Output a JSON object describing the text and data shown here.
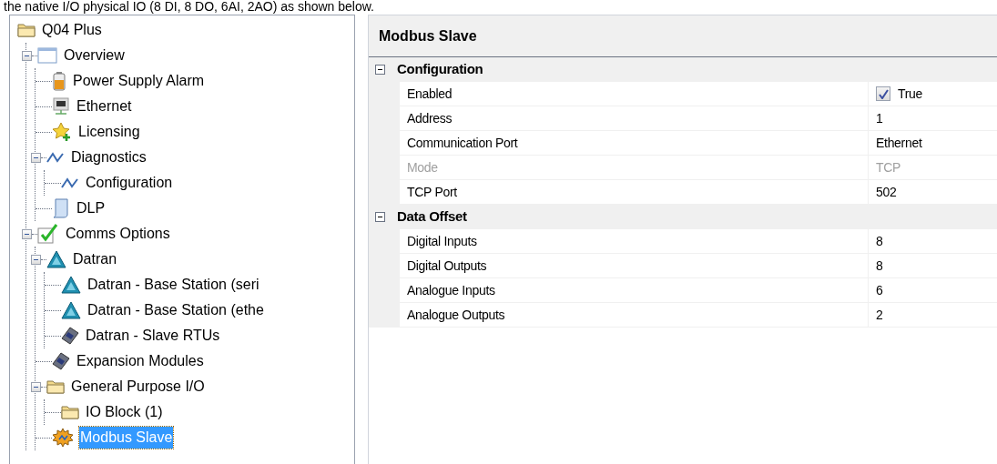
{
  "caption": "the native I/O physical IO (8 DI, 8 DO, 6AI, 2AO) as shown below.",
  "tree": [
    {
      "label": "Q04 Plus",
      "kind": "folder",
      "selected": false,
      "children": [
        {
          "label": "Overview",
          "kind": "window",
          "selected": false,
          "expanded": true,
          "children": [
            {
              "label": "Power Supply Alarm",
              "kind": "battery",
              "selected": false
            },
            {
              "label": "Ethernet",
              "kind": "network",
              "selected": false
            },
            {
              "label": "Licensing",
              "kind": "star",
              "selected": false
            },
            {
              "label": "Diagnostics",
              "kind": "wave",
              "selected": false,
              "expanded": true,
              "children": [
                {
                  "label": "Configuration",
                  "kind": "wave",
                  "selected": false
                }
              ]
            },
            {
              "label": "DLP",
              "kind": "document",
              "selected": false
            }
          ]
        },
        {
          "label": "Comms Options",
          "kind": "check",
          "selected": false,
          "expanded": true,
          "children": [
            {
              "label": "Datran",
              "kind": "triangle",
              "selected": false,
              "expanded": true,
              "children": [
                {
                  "label": "Datran - Base Station (seri",
                  "kind": "triangle",
                  "selected": false
                },
                {
                  "label": "Datran - Base Station (ethe",
                  "kind": "triangle",
                  "selected": false
                },
                {
                  "label": "Datran - Slave RTUs",
                  "kind": "module",
                  "selected": false
                }
              ]
            },
            {
              "label": "Expansion Modules",
              "kind": "module",
              "selected": false
            },
            {
              "label": "General Purpose I/O",
              "kind": "folder",
              "selected": false,
              "expanded": true,
              "children": [
                {
                  "label": "IO Block (1)",
                  "kind": "folder",
                  "selected": false
                }
              ]
            },
            {
              "label": "Modbus Slave",
              "kind": "gear",
              "selected": true
            }
          ]
        }
      ]
    }
  ],
  "panel": {
    "title": "Modbus Slave",
    "categories": [
      {
        "title": "Configuration",
        "expanded": true,
        "properties": [
          {
            "name": "Enabled",
            "value": "True",
            "kind": "checkbox",
            "checked": true,
            "disabled": false
          },
          {
            "name": "Address",
            "value": "1",
            "kind": "text",
            "disabled": false
          },
          {
            "name": "Communication Port",
            "value": "Ethernet",
            "kind": "text",
            "disabled": false
          },
          {
            "name": "Mode",
            "value": "TCP",
            "kind": "text",
            "disabled": true
          },
          {
            "name": "TCP Port",
            "value": "502",
            "kind": "text",
            "disabled": false
          }
        ]
      },
      {
        "title": "Data Offset",
        "expanded": true,
        "properties": [
          {
            "name": "Digital Inputs",
            "value": "8",
            "kind": "text",
            "disabled": false
          },
          {
            "name": "Digital Outputs",
            "value": "8",
            "kind": "text",
            "disabled": false
          },
          {
            "name": "Analogue Inputs",
            "value": "6",
            "kind": "text",
            "disabled": false
          },
          {
            "name": "Analogue Outputs",
            "value": "2",
            "kind": "text",
            "disabled": false
          }
        ]
      }
    ]
  }
}
